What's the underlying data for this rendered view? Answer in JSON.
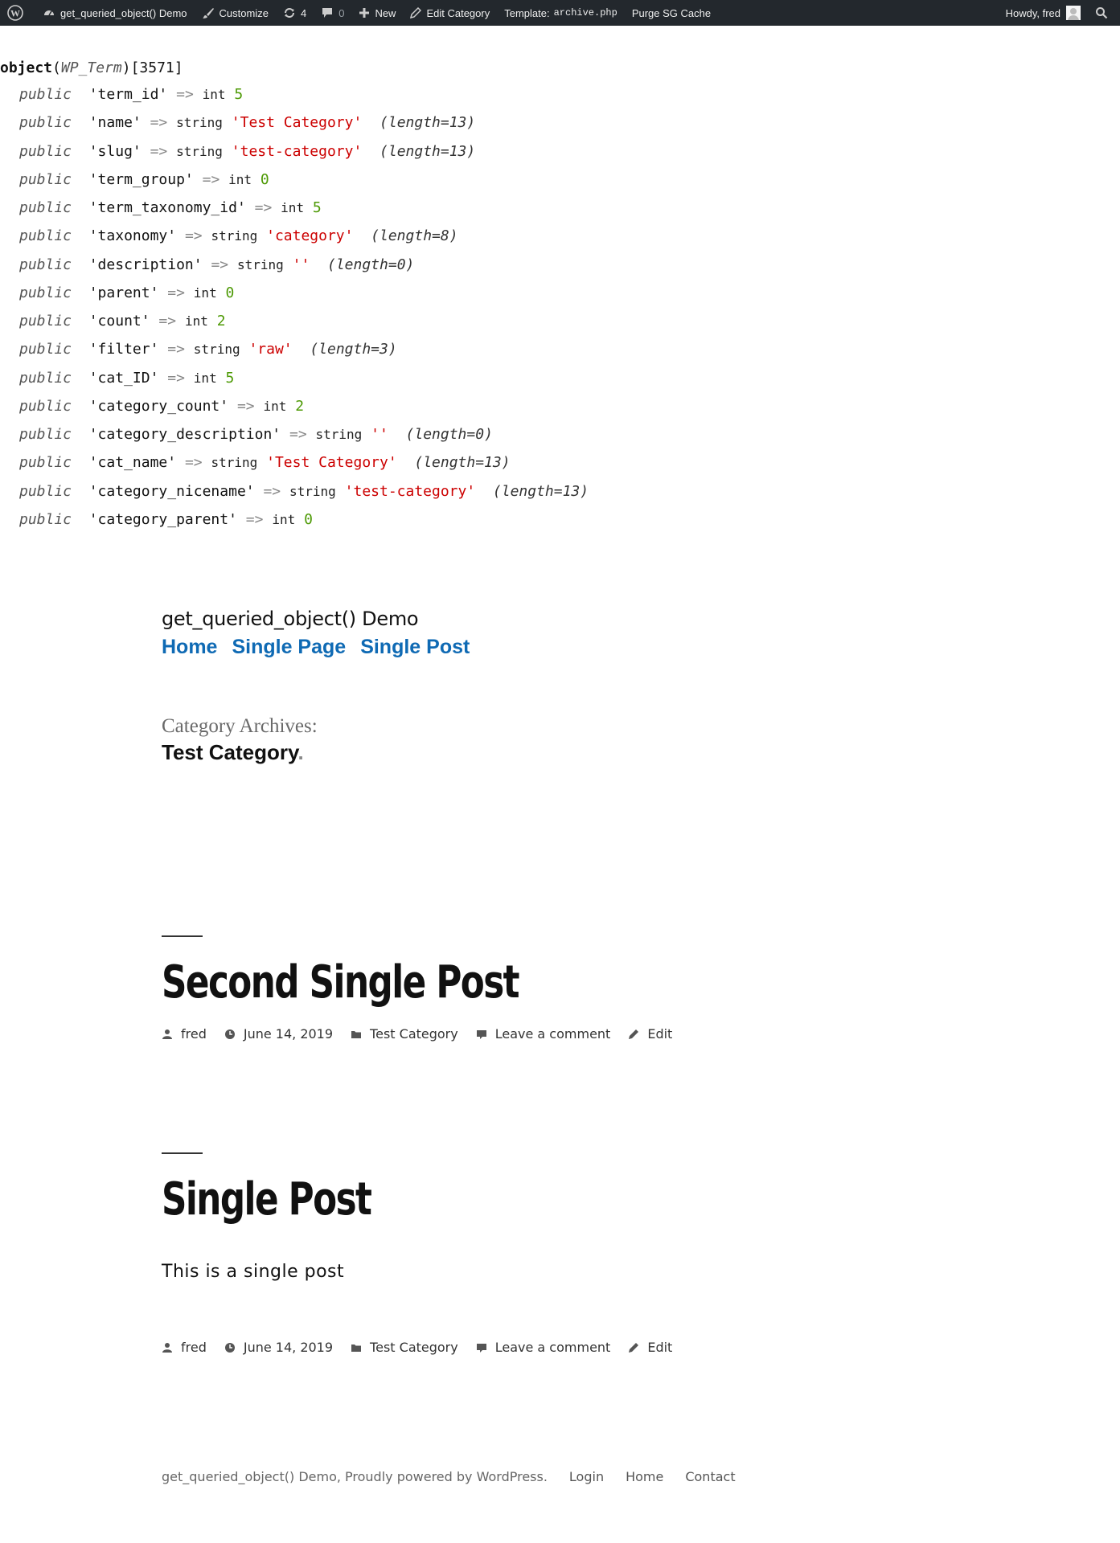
{
  "adminbar": {
    "site_name": "get_queried_object() Demo",
    "customize": "Customize",
    "updates_count": "4",
    "comments_count": "0",
    "new": "New",
    "edit_category": "Edit Category",
    "template_label": "Template:",
    "template_file": "archive.php",
    "purge": "Purge SG Cache",
    "howdy": "Howdy, fred"
  },
  "dump": {
    "object_kw": "object",
    "class_name": "WP_Term",
    "object_id": "[3571]",
    "public_kw": "public",
    "arrow": "=>",
    "rows": [
      {
        "key": "'term_id'",
        "type": "int",
        "value": "5",
        "kind": "num",
        "length": ""
      },
      {
        "key": "'name'",
        "type": "string",
        "value": "'Test Category'",
        "kind": "str",
        "length": "(length=13)"
      },
      {
        "key": "'slug'",
        "type": "string",
        "value": "'test-category'",
        "kind": "str",
        "length": "(length=13)"
      },
      {
        "key": "'term_group'",
        "type": "int",
        "value": "0",
        "kind": "num",
        "length": ""
      },
      {
        "key": "'term_taxonomy_id'",
        "type": "int",
        "value": "5",
        "kind": "num",
        "length": ""
      },
      {
        "key": "'taxonomy'",
        "type": "string",
        "value": "'category'",
        "kind": "str",
        "length": "(length=8)"
      },
      {
        "key": "'description'",
        "type": "string",
        "value": "''",
        "kind": "str",
        "length": "(length=0)"
      },
      {
        "key": "'parent'",
        "type": "int",
        "value": "0",
        "kind": "num",
        "length": ""
      },
      {
        "key": "'count'",
        "type": "int",
        "value": "2",
        "kind": "num",
        "length": ""
      },
      {
        "key": "'filter'",
        "type": "string",
        "value": "'raw'",
        "kind": "str",
        "length": "(length=3)"
      },
      {
        "key": "'cat_ID'",
        "type": "int",
        "value": "5",
        "kind": "num",
        "length": ""
      },
      {
        "key": "'category_count'",
        "type": "int",
        "value": "2",
        "kind": "num",
        "length": ""
      },
      {
        "key": "'category_description'",
        "type": "string",
        "value": "''",
        "kind": "str",
        "length": "(length=0)"
      },
      {
        "key": "'cat_name'",
        "type": "string",
        "value": "'Test Category'",
        "kind": "str",
        "length": "(length=13)"
      },
      {
        "key": "'category_nicename'",
        "type": "string",
        "value": "'test-category'",
        "kind": "str",
        "length": "(length=13)"
      },
      {
        "key": "'category_parent'",
        "type": "int",
        "value": "0",
        "kind": "num",
        "length": ""
      }
    ]
  },
  "site": {
    "title": "get_queried_object() Demo",
    "menu": [
      "Home",
      "Single Page",
      "Single Post"
    ]
  },
  "archive": {
    "label": "Category Archives:",
    "name": "Test Category",
    "dot": "."
  },
  "posts": [
    {
      "title": "Second Single Post",
      "body": "",
      "meta": {
        "author": "fred",
        "date": "June 14, 2019",
        "category": "Test Category",
        "comment": "Leave a comment",
        "edit": "Edit"
      }
    },
    {
      "title": "Single Post",
      "body": "This is a single post",
      "meta": {
        "author": "fred",
        "date": "June 14, 2019",
        "category": "Test Category",
        "comment": "Leave a comment",
        "edit": "Edit"
      }
    }
  ],
  "footer": {
    "credit": "get_queried_object() Demo, Proudly powered by WordPress.",
    "links": [
      "Login",
      "Home",
      "Contact"
    ]
  },
  "colors": {
    "adminbar_bg": "#23282d",
    "menu_link": "#0f6ab4",
    "int_value": "#4e9a06",
    "string_value": "#cc0000"
  }
}
